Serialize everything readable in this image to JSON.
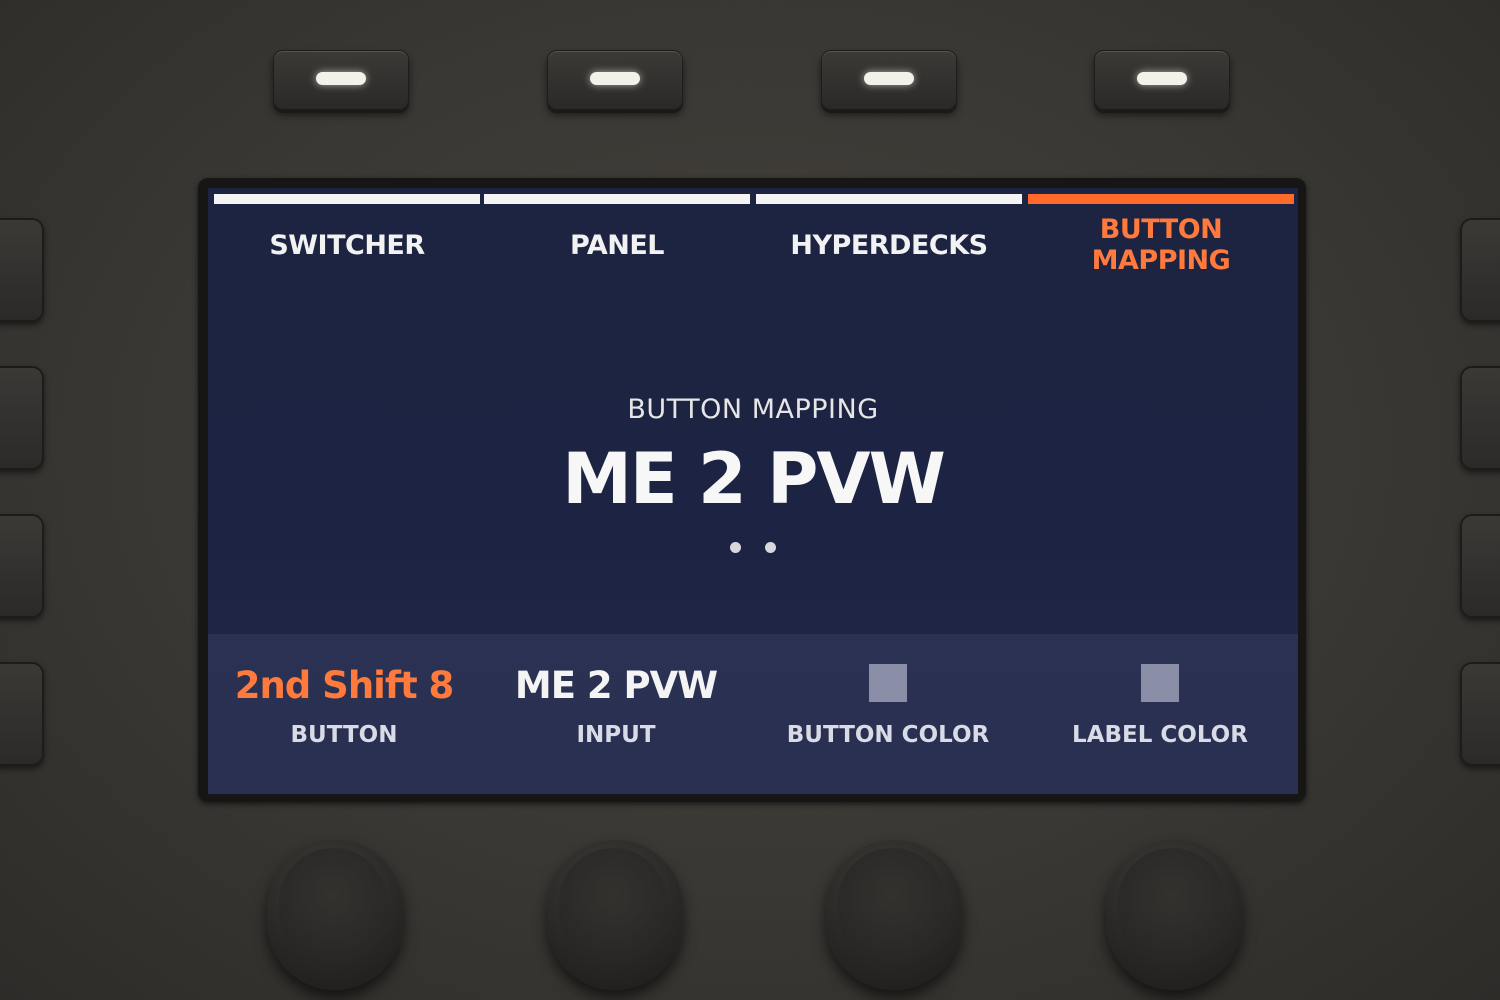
{
  "tabs": [
    {
      "label": "SWITCHER",
      "active": false
    },
    {
      "label": "PANEL",
      "active": false
    },
    {
      "label": "HYPERDECKS",
      "active": false
    },
    {
      "label": "BUTTON\nMAPPING",
      "active": true
    }
  ],
  "center": {
    "caption": "BUTTON MAPPING",
    "value": "ME 2 PVW",
    "page_count": 2
  },
  "params": [
    {
      "value": "2nd Shift 8",
      "label": "BUTTON"
    },
    {
      "value": "ME 2 PVW",
      "label": "INPUT"
    },
    {
      "value": "",
      "label": "BUTTON COLOR",
      "swatch": "#8a8ea6"
    },
    {
      "value": "",
      "label": "LABEL COLOR",
      "swatch": "#8a8ea6"
    }
  ],
  "colors": {
    "accent": "#ff6a2a",
    "screen_bg": "#1d2442",
    "text": "#f4f4f4"
  }
}
